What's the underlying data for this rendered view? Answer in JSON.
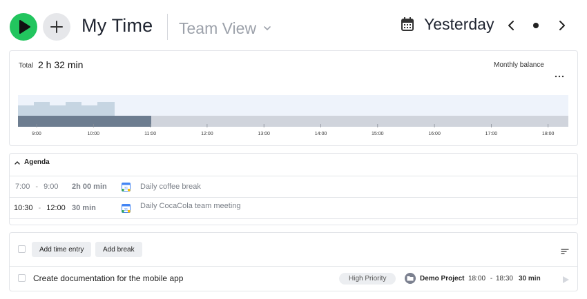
{
  "header": {
    "title": "My Time",
    "view_selector": "Team View",
    "date_label": "Yesterday",
    "icons": {
      "start": "play-icon",
      "add": "plus-icon",
      "view_dropdown": "chevron-down-icon",
      "calendar": "calendar-icon",
      "prev": "chevron-left-icon",
      "today": "dot-icon",
      "next": "chevron-right-icon"
    },
    "colors": {
      "start_button": "#22c55e",
      "add_button": "#e6e7ea"
    }
  },
  "timeline": {
    "total_label": "Total",
    "total_value": "2 h 32 min",
    "monthly_balance": "Monthly balance",
    "more_icon": "more-horizontal-icon",
    "hours": [
      "9:00",
      "10:00",
      "11:00",
      "12:00",
      "13:00",
      "14:00",
      "15:00",
      "16:00",
      "17:00",
      "18:00"
    ],
    "colors": {
      "tracked_bar": "#6d7d90",
      "empty_bar": "#d0d4dc",
      "histogram": "#c6d5e2",
      "histogram_bg": "#eef3fb"
    }
  },
  "agenda": {
    "title": "Agenda",
    "toggle_icon": "chevron-up-icon",
    "events": [
      {
        "start": "7:00",
        "end": "9:00",
        "separator": "-",
        "duration": "2h 00 min",
        "title": "Daily coffee break",
        "icon": "google-calendar-icon"
      },
      {
        "start": "10:30",
        "end": "12:00",
        "separator": "-",
        "duration": "30 min",
        "title": "Daily CocaCola team meeting",
        "icon": "google-calendar-icon"
      }
    ]
  },
  "entries": {
    "add_time_entry": "Add time entry",
    "add_break": "Add break",
    "sort_icon": "sort-icon",
    "items": [
      {
        "title": "Create documentation for the mobile app",
        "tag": "High Priority",
        "project": "Demo Project",
        "project_icon": "folder-icon",
        "start": "18:00",
        "end": "18:30",
        "duration": "30 min",
        "play_icon": "play-icon"
      }
    ]
  }
}
